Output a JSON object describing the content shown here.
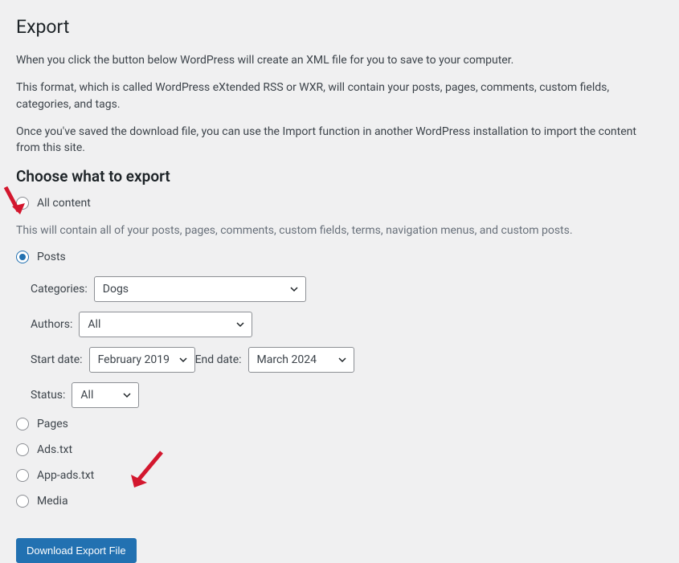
{
  "title": "Export",
  "intro": [
    "When you click the button below WordPress will create an XML file for you to save to your computer.",
    "This format, which is called WordPress eXtended RSS or WXR, will contain your posts, pages, comments, custom fields, categories, and tags.",
    "Once you've saved the download file, you can use the Import function in another WordPress installation to import the content from this site."
  ],
  "section_title": "Choose what to export",
  "radios": {
    "all": "All content",
    "all_desc": "This will contain all of your posts, pages, comments, custom fields, terms, navigation menus, and custom posts.",
    "posts": "Posts",
    "pages": "Pages",
    "ads": "Ads.txt",
    "appads": "App-ads.txt",
    "media": "Media"
  },
  "filters": {
    "categories_label": "Categories:",
    "categories_value": "Dogs",
    "authors_label": "Authors:",
    "authors_value": "All",
    "start_date_label": "Start date:",
    "start_date_value": "February 2019",
    "end_date_label": "End date:",
    "end_date_value": "March 2024",
    "status_label": "Status:",
    "status_value": "All"
  },
  "button": "Download Export File"
}
